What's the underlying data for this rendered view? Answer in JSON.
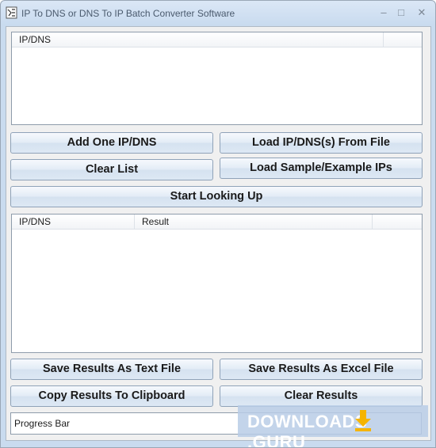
{
  "window": {
    "title": "IP To DNS or DNS To IP Batch Converter Software"
  },
  "title_controls": {
    "minimize": "–",
    "maximize": "□",
    "close": "✕"
  },
  "input_list": {
    "columns": [
      "IP/DNS"
    ]
  },
  "buttons": {
    "add_one": "Add One IP/DNS",
    "load_from_file": "Load IP/DNS(s) From File",
    "clear_list": "Clear List",
    "load_sample": "Load Sample/Example IPs",
    "start": "Start Looking Up",
    "save_text": "Save Results As Text File",
    "save_excel": "Save Results As Excel File",
    "copy_clipboard": "Copy Results To Clipboard",
    "clear_results": "Clear Results"
  },
  "results_list": {
    "columns": [
      "IP/DNS",
      "Result"
    ]
  },
  "status": {
    "text": "Progress Bar"
  },
  "watermark": {
    "left": "DOWNLOADS",
    "right": ".GURU",
    "icon": "download-arrow-icon",
    "color": "#f5b400"
  }
}
